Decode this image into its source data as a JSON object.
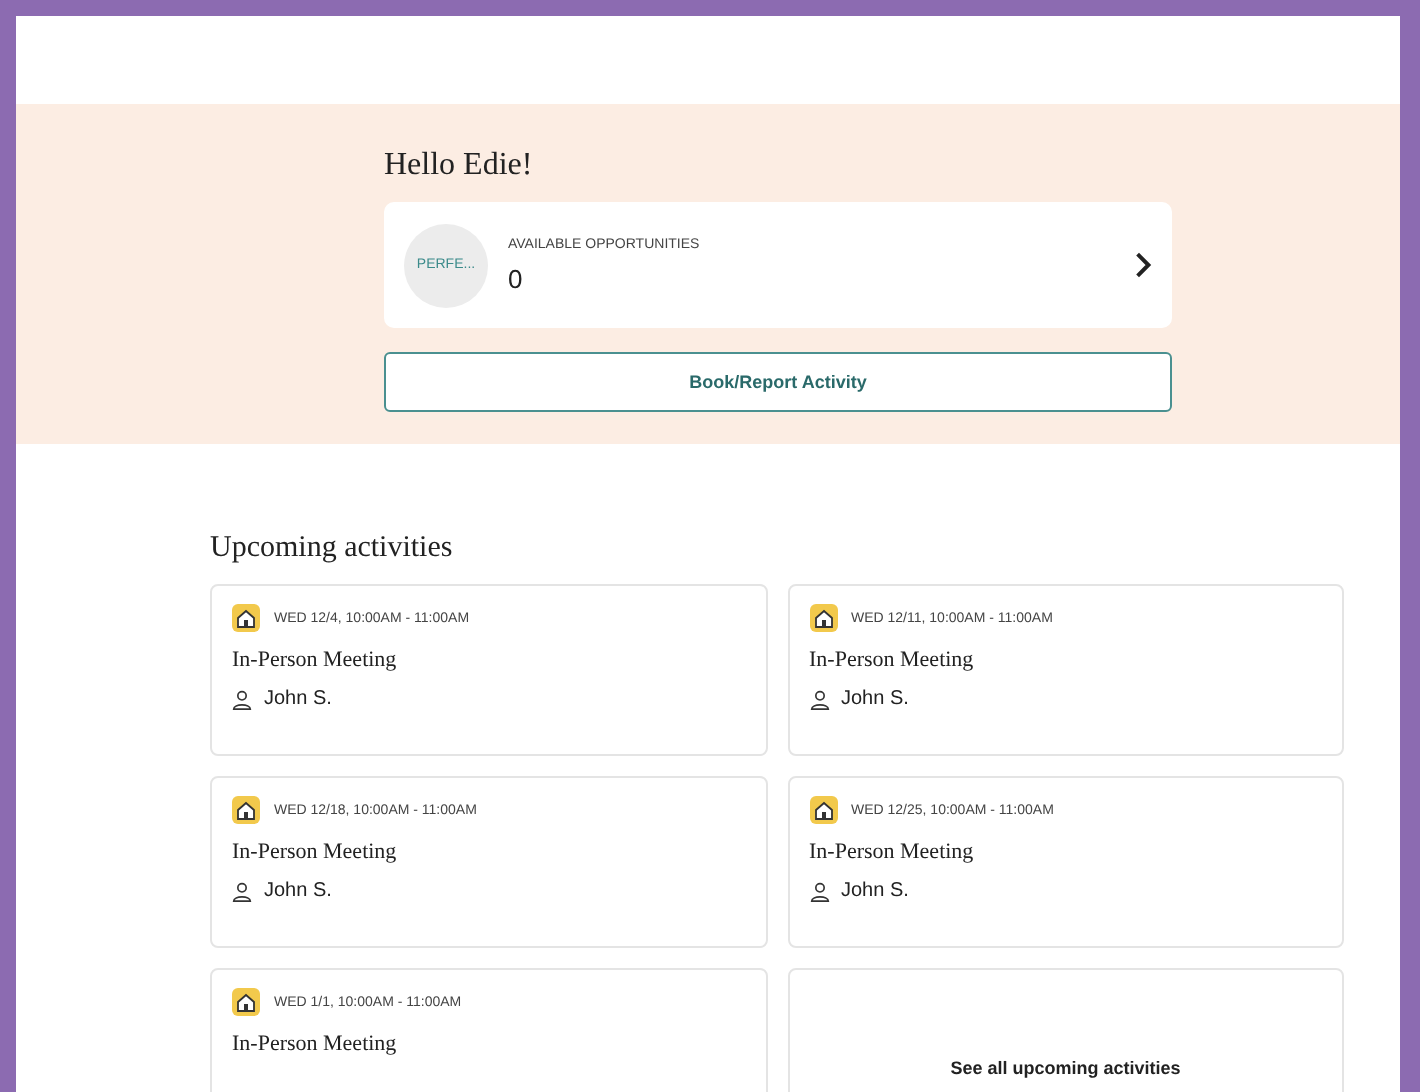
{
  "greeting": "Hello Edie!",
  "opportunities": {
    "avatar_text": "PERFE...",
    "label": "AVAILABLE OPPORTUNITIES",
    "count": "0"
  },
  "book_button": "Book/Report Activity",
  "upcoming": {
    "title": "Upcoming activities",
    "cards": [
      {
        "kind": "activity",
        "when": "WED 12/4, 10:00AM - 11:00AM",
        "title": "In-Person Meeting",
        "person": "John S."
      },
      {
        "kind": "activity",
        "when": "WED 12/11, 10:00AM - 11:00AM",
        "title": "In-Person Meeting",
        "person": "John S."
      },
      {
        "kind": "activity",
        "when": "WED 12/18, 10:00AM - 11:00AM",
        "title": "In-Person Meeting",
        "person": "John S."
      },
      {
        "kind": "activity",
        "when": "WED 12/25, 10:00AM - 11:00AM",
        "title": "In-Person Meeting",
        "person": "John S."
      },
      {
        "kind": "activity",
        "when": "WED 1/1, 10:00AM - 11:00AM",
        "title": "In-Person Meeting"
      },
      {
        "kind": "link",
        "label": "See all upcoming activities"
      }
    ]
  }
}
